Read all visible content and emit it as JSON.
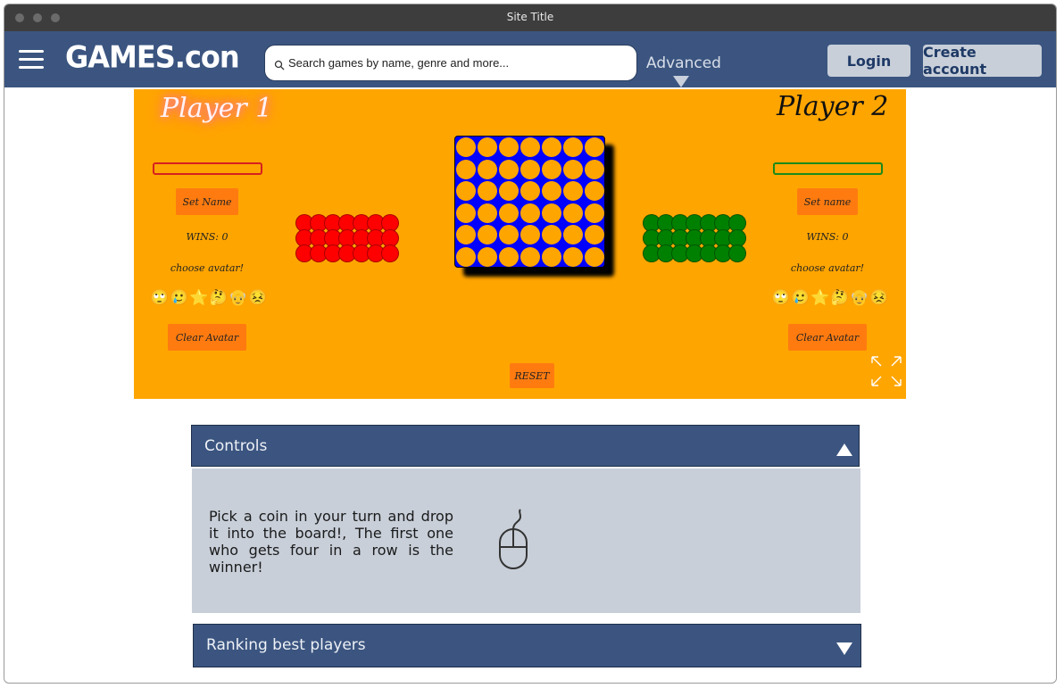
{
  "window": {
    "title": "Site Title"
  },
  "navbar": {
    "logo": "GAMES.con",
    "search_placeholder": "Search games by name, genre and more...",
    "advanced_label": "Advanced",
    "login_label": "Login",
    "create_account_label": "Create account"
  },
  "game": {
    "player1": {
      "title": "Player 1",
      "set_name_label": "Set Name",
      "wins_label": "WINS: 0",
      "choose_avatar_label": "choose avatar!",
      "clear_avatar_label": "Clear Avatar",
      "color": "#ff0000",
      "name_bar_color": "#d62020"
    },
    "player2": {
      "title": "Player 2",
      "set_name_label": "Set name",
      "wins_label": "WINS: 0",
      "choose_avatar_label": "choose avatar!",
      "clear_avatar_label": "Clear Avatar",
      "color": "#008000",
      "name_bar_color": "#1a8a1a"
    },
    "avatars": [
      "🙄",
      "🥲",
      "⭐",
      "🤔",
      "👴",
      "😣"
    ],
    "reset_label": "RESET",
    "board_columns": 7,
    "board_rows": 6,
    "coins_per_player": 21,
    "colors": {
      "background": "#ffa500",
      "board": "#0000ff",
      "button": "#ff7b10"
    }
  },
  "sections": {
    "controls": {
      "title": "Controls",
      "text": "Pick a coin in your turn and drop it into the board!, The first one who gets four in a row is the winner!",
      "icon": "mouse-icon",
      "expanded": true
    },
    "ranking": {
      "title": "Ranking best players",
      "expanded": false
    }
  },
  "colors": {
    "navbar": "#3b5580",
    "panel_body": "#c8cfd9",
    "nav_button": "#c8cfd9"
  }
}
